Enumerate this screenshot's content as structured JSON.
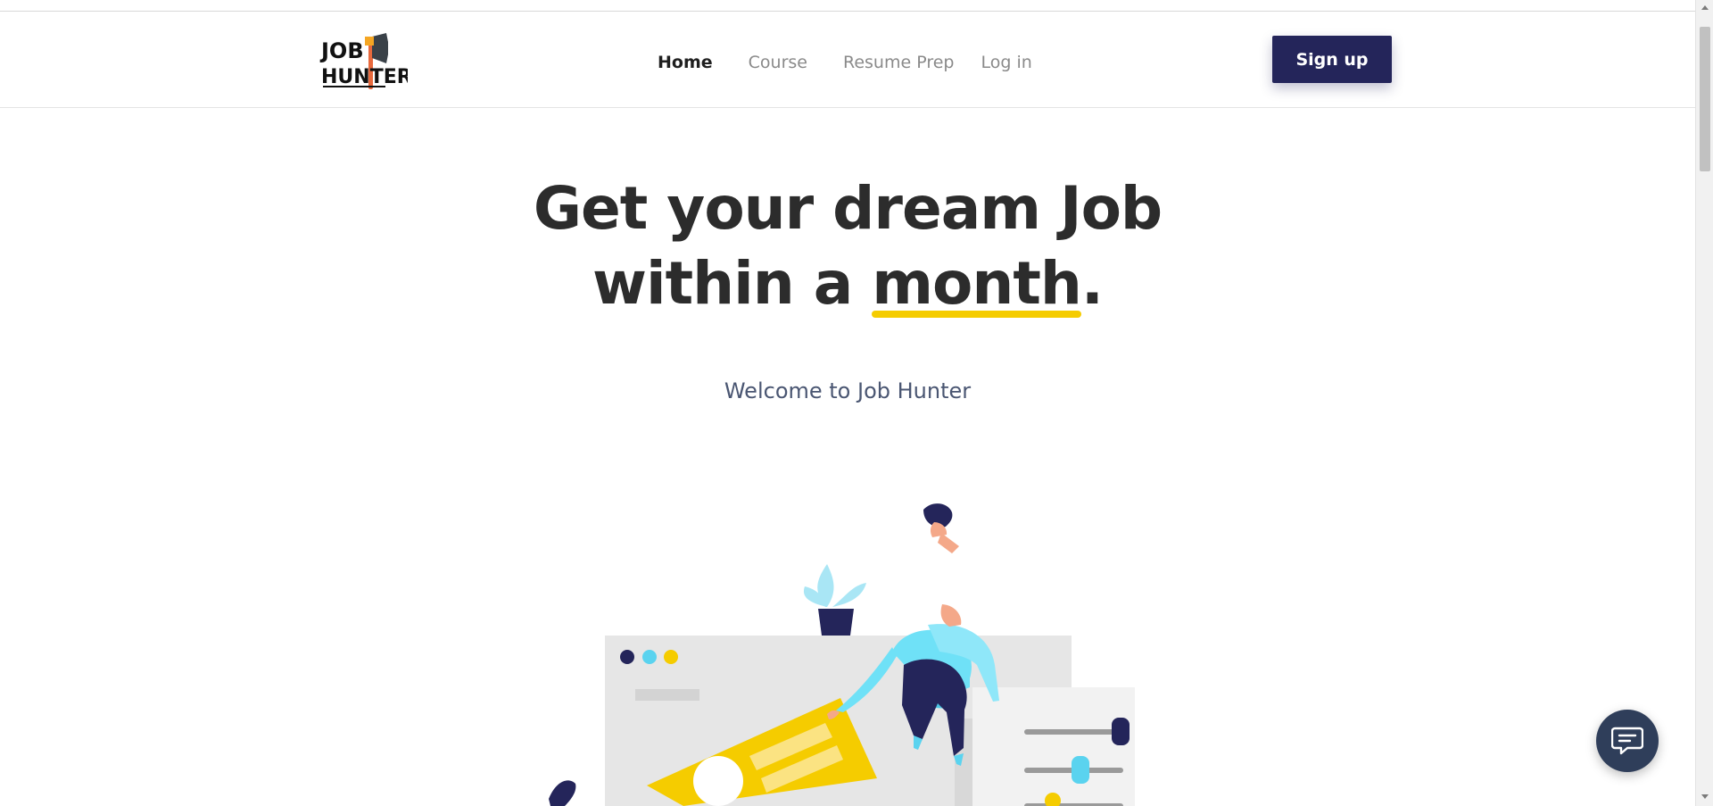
{
  "header": {
    "logo": {
      "line1": "JOB",
      "line2": "HUNTER",
      "icon": "axe-icon"
    },
    "nav": [
      {
        "label": "Home",
        "active": true
      },
      {
        "label": "Course",
        "active": false
      },
      {
        "label": "Resume Prep",
        "active": false
      },
      {
        "label": "Log in",
        "active": false
      }
    ],
    "signup_label": "Sign up"
  },
  "hero": {
    "title_line1": "Get your dream Job",
    "title_line2_prefix": "within a ",
    "title_line2_emphasis": "month",
    "title_line2_suffix": ".",
    "subtitle": "Welcome to Job Hunter"
  },
  "chat_widget": {
    "icon": "chat-icon"
  },
  "colors": {
    "brand_navy": "#24255a",
    "accent_yellow": "#f5cc00",
    "accent_cyan": "#5ad3ef",
    "text_dark": "#2c2c2c",
    "text_muted": "#8a8a8a",
    "subtitle": "#4a5672",
    "chat_bg": "#2f3e5a"
  }
}
